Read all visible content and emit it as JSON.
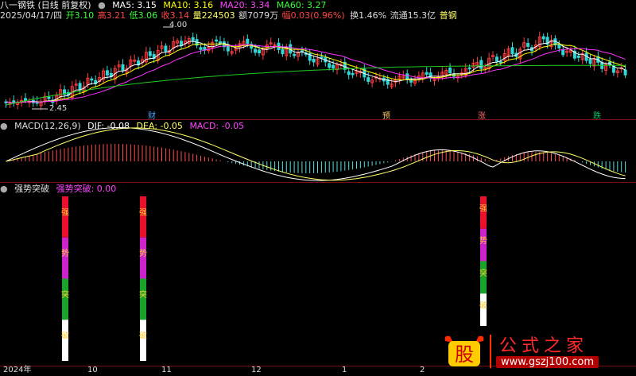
{
  "header": {
    "title": "八一钢铁 (日线 前复权)",
    "ma5_label": "MA5: 3.15",
    "ma10_label": "MA10: 3.16",
    "ma20_label": "MA20: 3.34",
    "ma60_label": "MA60: 3.27",
    "colors": {
      "ma5": "#ffffff",
      "ma10": "#ffff00",
      "ma20": "#ff00ff",
      "ma60": "#00ff00"
    }
  },
  "quote": {
    "date": "2025/04/17/四",
    "open": "开3.10",
    "high": "高3.21",
    "low": "低3.06",
    "close": "收3.14",
    "volume": "量224503",
    "amount": "额7079万",
    "change": "幅0.03(0.96%)",
    "turnover": "换1.46%",
    "float_cap": "流通15.3亿",
    "sector": "普钢"
  },
  "price_panel": {
    "high_label": "4.00",
    "low_label": "2.45",
    "markers": [
      {
        "text": "财",
        "color": "#4aa3ff"
      },
      {
        "text": "预",
        "color": "#ffcc66"
      },
      {
        "text": "涨",
        "color": "#ff6666"
      },
      {
        "text": "跌",
        "color": "#00cc66"
      }
    ]
  },
  "macd_panel": {
    "label": "MACD(12,26,9)",
    "dif": "DIF: -0.08",
    "dea": "DEA: -0.05",
    "macd": "MACD: -0.05"
  },
  "signal_panel": {
    "label": "强势突破",
    "value_label": "强势突破: 0.00",
    "bar_chars": [
      "强",
      "势",
      "突",
      "破"
    ],
    "bar_colors": [
      "#e8102a",
      "#cc22cc",
      "#1aa32a",
      "#ffffff"
    ]
  },
  "axis": {
    "labels": [
      "2024年",
      "10",
      "11",
      "12",
      "1",
      "2"
    ]
  },
  "watermark": {
    "icon_text": "股",
    "brand": "公式之家",
    "url": "www.gszj100.com"
  }
}
